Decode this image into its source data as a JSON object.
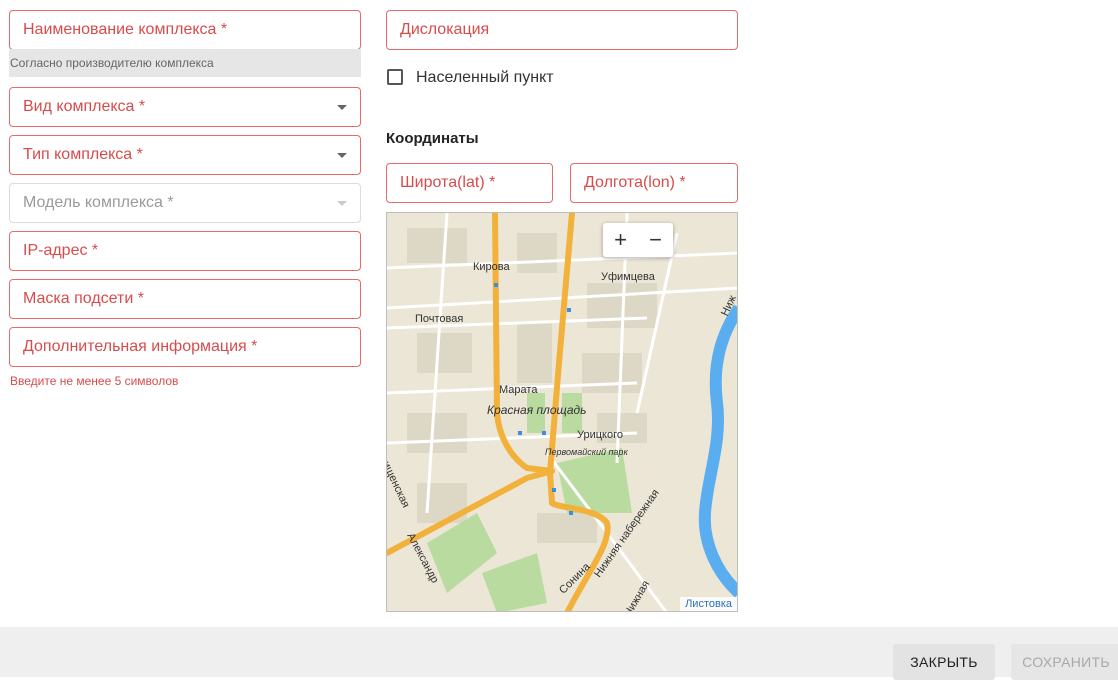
{
  "left_column": {
    "name_field": {
      "label": "Наименование комплекса *",
      "hint": "Согласно производителю комплекса"
    },
    "kind_field": {
      "label": "Вид комплекса *"
    },
    "type_field": {
      "label": "Тип комплекса *"
    },
    "model_field": {
      "label": "Модель комплекса *"
    },
    "ip_field": {
      "label": "IP-адрес *"
    },
    "mask_field": {
      "label": "Маска подсети *"
    },
    "info_field": {
      "label": "Дополнительная информация *",
      "error": "Введите не менее 5 символов"
    }
  },
  "right_column": {
    "location_field": {
      "label": "Дислокация"
    },
    "settlement_checkbox": {
      "label": "Населенный пункт",
      "checked": false
    },
    "coordinates": {
      "title": "Координаты",
      "lat_label": "Широта(lat) *",
      "lon_label": "Долгота(lon) *"
    },
    "map": {
      "zoom_in": "+",
      "zoom_out": "−",
      "attribution": "Листовка",
      "labels": {
        "kirova": "Кирова",
        "ufimtseva": "Уфимцева",
        "pochtovaya": "Почтовая",
        "marata": "Марата",
        "krasnaya": "Красная площадь",
        "uritskogo": "Урицкого",
        "pervomaisky": "Первомайский парк",
        "novishchenskaya": "ровищенская",
        "aleksandr": "Александр",
        "sonina": "Сонина",
        "naberezhnaya": "Нижняя набережная",
        "nizh": "Ниж",
        "nizhnaya": "Нижная"
      }
    }
  },
  "footer": {
    "close_label": "ЗАКРЫТЬ",
    "save_label": "СОХРАНИТЬ"
  },
  "colors": {
    "error_red": "#d84b4b",
    "road_orange": "#f2b13a",
    "river_blue": "#5aaef0",
    "park_green": "#a8d08d"
  }
}
